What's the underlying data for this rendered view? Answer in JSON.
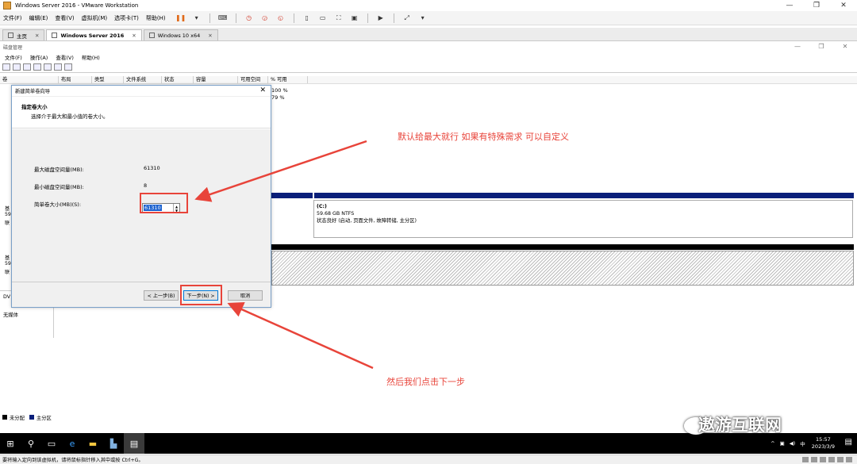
{
  "app": {
    "title": "Windows Server 2016 - VMware Workstation",
    "menu": [
      "文件(F)",
      "编辑(E)",
      "查看(V)",
      "虚拟机(M)",
      "选项卡(T)",
      "帮助(H)"
    ],
    "tabs": [
      {
        "label": "主页"
      },
      {
        "label": "Windows Server 2016"
      },
      {
        "label": "Windows 10 x64"
      }
    ]
  },
  "disk_mgmt": {
    "title": "磁盘管理",
    "menu": [
      "文件(F)",
      "操作(A)",
      "查看(V)",
      "帮助(H)"
    ],
    "columns": [
      "卷",
      "布局",
      "类型",
      "文件系统",
      "状态",
      "容量",
      "可用空间",
      "% 可用"
    ],
    "pct_values": [
      "100 %",
      "79 %"
    ],
    "c_partition": {
      "name": "(C:)",
      "size": "59.68 GB NTFS",
      "status": "状态良好 (启动, 页面文件, 故障转储, 主分区)"
    },
    "left_labels": {
      "disk0": [
        "基",
        "59",
        "联"
      ],
      "disk1": [
        "基",
        "59",
        "联"
      ]
    },
    "dvd": {
      "label": "DV",
      "nomedia": "无媒体"
    },
    "legend": [
      {
        "label": "未分配",
        "color": "#000000"
      },
      {
        "label": "主分区",
        "color": "#0a1f7a"
      }
    ]
  },
  "wizard": {
    "title": "新建简单卷向导",
    "header": "指定卷大小",
    "subheader": "选择介于最大和最小值的卷大小。",
    "max_label": "最大磁盘空间量(MB):",
    "max_value": "61310",
    "min_label": "最小磁盘空间量(MB):",
    "min_value": "8",
    "size_label": "简单卷大小(MB)(S):",
    "size_value": "61310",
    "back_button": "< 上一步(B)",
    "next_button": "下一步(N) >",
    "cancel_button": "取消"
  },
  "annotations": {
    "top": "默认给最大就行 如果有特殊需求 可以自定义",
    "bottom": "然后我们点击下一步"
  },
  "taskbar": {
    "time": "15:57",
    "date": "2023/3/9",
    "ime": "中"
  },
  "watermark": "遨游互联网",
  "statusbar": "要将输入定向到该虚拟机，请将鼠标指针移入其中或按 Ctrl+G。"
}
